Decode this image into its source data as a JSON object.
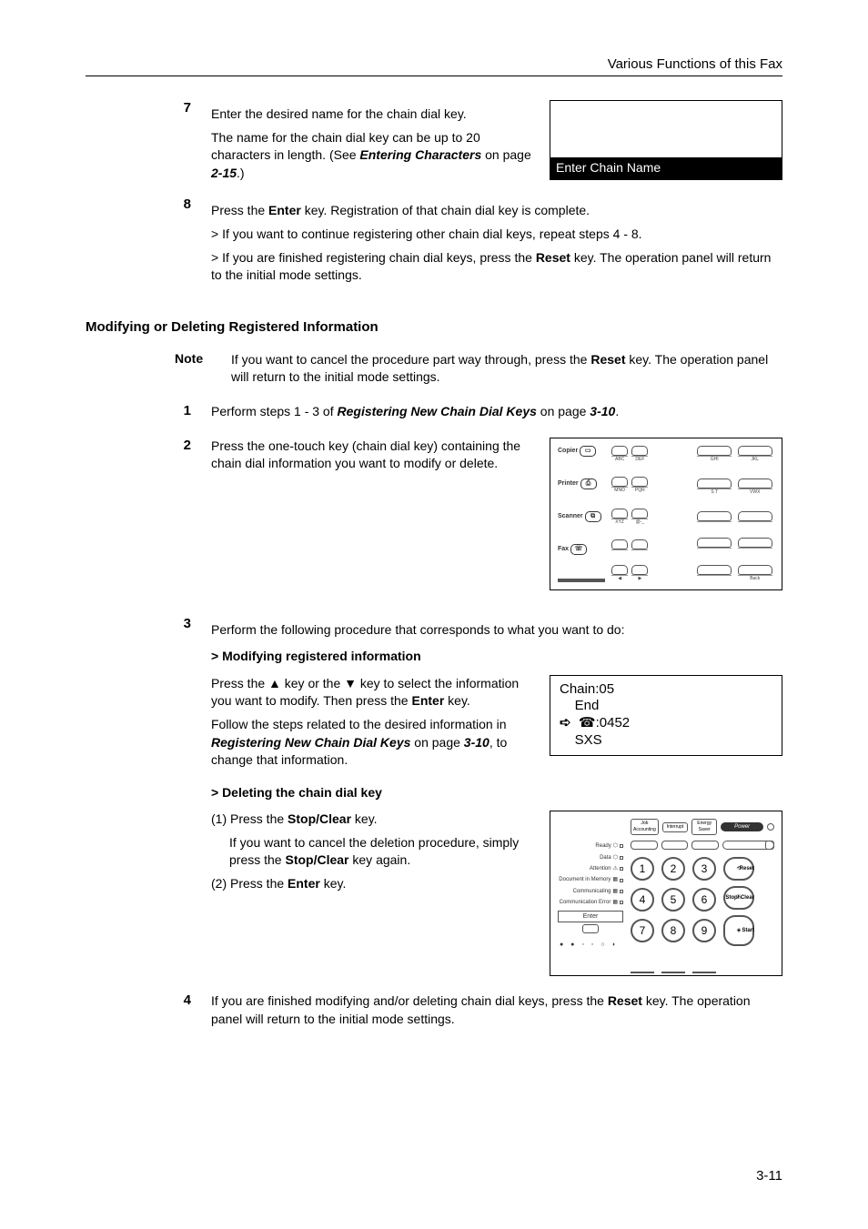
{
  "header": "Various Functions of this Fax",
  "step7": {
    "num": "7",
    "line1": "Enter the desired name for the chain dial key.",
    "line2a": "The name for the chain dial key can be up to 20 characters in length. (See ",
    "line2b": "Entering Characters",
    "line2c": " on page ",
    "line2d": "2-15",
    "line2e": ".)"
  },
  "lcd1": {
    "title": "Enter Chain Name"
  },
  "step8": {
    "num": "8",
    "intro_a": "Press the ",
    "intro_b": "Enter",
    "intro_c": " key. Registration of that chain dial key is complete.",
    "b1": "> If you want to continue registering other chain dial keys, repeat steps 4 - 8.",
    "b2a": "> If you are finished registering chain dial keys, press the ",
    "b2b": "Reset",
    "b2c": " key. The operation panel will return to the initial mode settings."
  },
  "section_heading": "Modifying or Deleting Registered Information",
  "note": {
    "label": "Note",
    "ta": "If you want to cancel the procedure part way through, press the ",
    "tb": "Reset",
    "tc": " key. The operation panel will return to the initial mode settings."
  },
  "step1": {
    "num": "1",
    "ta": "Perform steps 1 - 3 of ",
    "tb": "Registering New Chain Dial Keys",
    "tc": " on page ",
    "td": "3-10",
    "te": "."
  },
  "step2": {
    "num": "2",
    "text": "Press the one-touch key (chain dial key) containing the chain dial information you want to modify or delete."
  },
  "keypad": {
    "modes": [
      "Copier",
      "Printer",
      "Scanner",
      "Fax"
    ],
    "r1": [
      "",
      "ABC",
      "DEF",
      "",
      "GHI",
      "JKL"
    ],
    "r2": [
      "",
      "MNO",
      "PQR",
      "",
      "S T",
      "VWX"
    ],
    "r3": [
      "",
      "XYZ",
      "@-_",
      "",
      "",
      ""
    ],
    "r4": [
      "",
      "",
      "",
      "",
      "",
      ""
    ],
    "r5": [
      "",
      "",
      "",
      "",
      "",
      "Back"
    ]
  },
  "step3": {
    "num": "3",
    "intro": "Perform the following procedure that corresponds to what you want to do:",
    "sub1": "> Modifying registered information",
    "p1a": "Press the ▲ key or the ▼ key to select the information you want to modify. Then press the ",
    "p1b": "Enter",
    "p1c": " key.",
    "p2a": "Follow the steps related to the desired information in ",
    "p2b": "Registering New Chain Dial Keys",
    "p2c": " on page ",
    "p2d": "3-10",
    "p2e": ", to change that information.",
    "sub2": "> Deleting the chain dial key",
    "d1a": "(1) Press the ",
    "d1b": "Stop/Clear",
    "d1c": " key.",
    "d1_suba": "If you want to cancel the deletion procedure, simply press the ",
    "d1_subb": "Stop/Clear",
    "d1_subc": " key again.",
    "d2a": "(2) Press the ",
    "d2b": "Enter",
    "d2c": " key."
  },
  "lcd2": {
    "l1": "Chain:05",
    "l2": "    End",
    "l3_prefix": "➪  ",
    "l3_icon": "☎",
    "l3_text": ":0452",
    "l4": "    SXS"
  },
  "numpad": {
    "statuses": [
      "Ready",
      "Data",
      "Attention",
      "Document in Memory",
      "Communicating",
      "Communication Error"
    ],
    "enter": "Enter",
    "top": {
      "a": "Job Accounting",
      "b": "Interrupt",
      "c": "Energy Saver",
      "d": "Power"
    },
    "nums": [
      "1",
      "2",
      "3",
      "4",
      "5",
      "6",
      "7",
      "8",
      "9"
    ],
    "side": [
      "Reset",
      "Stop/ Clear",
      "Start"
    ],
    "pct": "%"
  },
  "step4": {
    "num": "4",
    "ta": "If you are finished modifying and/or deleting chain dial keys, press the ",
    "tb": "Reset",
    "tc": " key. The operation panel will return to the initial mode settings."
  },
  "page_num": "3-11"
}
